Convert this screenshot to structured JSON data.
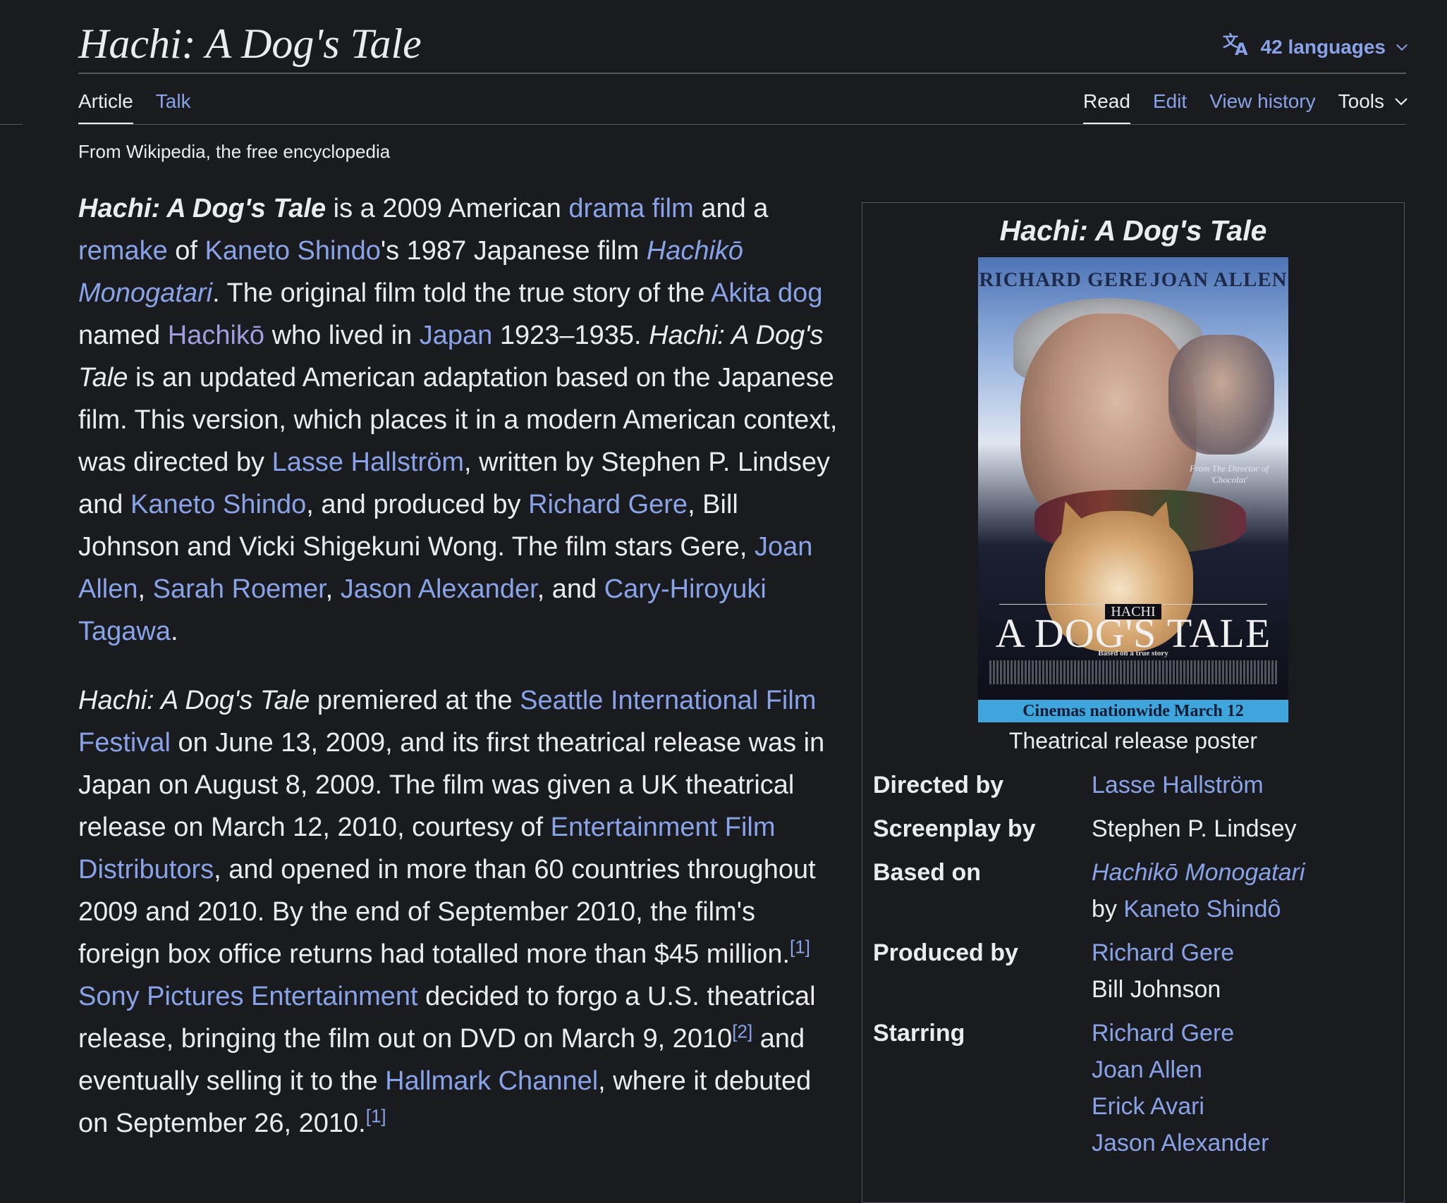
{
  "page": {
    "title": "Hachi: A Dog's Tale",
    "languages_label": "42 languages",
    "tagline": "From Wikipedia, the free encyclopedia"
  },
  "tabs": {
    "article": "Article",
    "talk": "Talk",
    "read": "Read",
    "edit": "Edit",
    "view_history": "View history",
    "tools": "Tools"
  },
  "icons": {
    "translate": "translate-icon",
    "chevron": "chevron-down-icon"
  },
  "colors": {
    "background": "#1a1b1f",
    "text": "#eaecf0",
    "link": "#88a3e8",
    "visited_link": "#a59ce0",
    "divider": "#54595d"
  },
  "paragraph1": {
    "title_bold": "Hachi: A Dog's Tale",
    "t1": " is a 2009 American ",
    "l_drama": "drama film",
    "t2": " and a ",
    "l_remake": "remake",
    "t3": " of ",
    "l_shindo": "Kaneto Shindo",
    "t4": "'s 1987 Japanese film ",
    "l_monogatari": "Hachikō Monogatari",
    "t5": ". The original film told the true story of the ",
    "l_akita": "Akita dog",
    "t6": " named ",
    "l_hachiko": "Hachikō",
    "t7": " who lived in ",
    "l_japan": "Japan",
    "t8": " 1923–1935. ",
    "title_italic": "Hachi: A Dog's Tale",
    "t9": " is an updated American adaptation based on the Japanese film. This version, which places it in a modern American context, was directed by ",
    "l_hallstrom": "Lasse Hallström",
    "t10": ", written by Stephen P. Lindsey and ",
    "l_shindo2": "Kaneto Shindo",
    "t11": ", and produced by ",
    "l_gere": "Richard Gere",
    "t12": ", Bill Johnson and Vicki Shigekuni Wong. The film stars Gere, ",
    "l_allen": "Joan Allen",
    "t13": ", ",
    "l_roemer": "Sarah Roemer",
    "t14": ", ",
    "l_alexander": "Jason Alexander",
    "t15": ", and ",
    "l_tagawa": "Cary-Hiroyuki Tagawa",
    "t16": "."
  },
  "paragraph2": {
    "title_italic": "Hachi: A Dog's Tale",
    "t1": " premiered at the ",
    "l_siff": "Seattle International Film Festival",
    "t2": " on June 13, 2009, and its first theatrical release was in Japan on August 8, 2009. The film was given a UK theatrical release on March 12, 2010, courtesy of ",
    "l_efd": "Entertainment Film Distributors",
    "t3": ", and opened in more than 60 countries throughout 2009 and 2010. By the end of September 2010, the film's foreign box office returns had totalled more than $45 million.",
    "ref1": "[1]",
    "t4": " ",
    "l_sony": "Sony Pictures Entertainment",
    "t5": " decided to forgo a U.S. theatrical release, bringing the film out on DVD on March 9, 2010",
    "ref2": "[2]",
    "t6": " and eventually selling it to the ",
    "l_hallmark": "Hallmark Channel",
    "t7": ", where it debuted on September 26, 2010.",
    "ref3": "[1]"
  },
  "infobox": {
    "title": "Hachi: A Dog's Tale",
    "poster": {
      "actor1": "RICHARD GERE",
      "actor2": "JOAN ALLEN",
      "director_line": "From The Director of 'Chocolat'",
      "hachi": "HACHI",
      "main_title": "A DOG'S TALE",
      "tagline": "Based on a true story",
      "band": "Cinemas nationwide March 12"
    },
    "caption": "Theatrical release poster",
    "directed_by_label": "Directed by",
    "directed_by": "Lasse Hallström",
    "screenplay_label": "Screenplay by",
    "screenplay": "Stephen P. Lindsey",
    "based_on_label": "Based on",
    "based_on_work": "Hachikō Monogatari",
    "based_on_by": "by ",
    "based_on_author": "Kaneto Shindô",
    "produced_label": "Produced by",
    "producers": [
      "Richard Gere",
      "Bill Johnson"
    ],
    "starring_label": "Starring",
    "starring": [
      "Richard Gere",
      "Joan Allen",
      "Erick Avari",
      "Jason Alexander"
    ]
  }
}
